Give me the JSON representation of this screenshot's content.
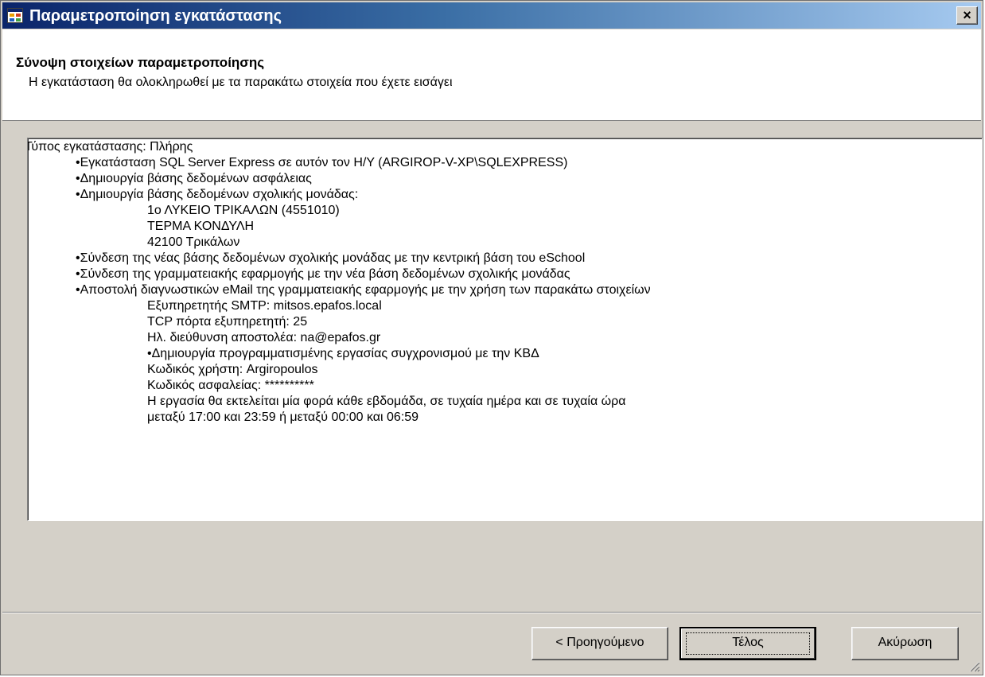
{
  "window": {
    "title": "Παραμετροποίηση εγκατάστασης",
    "close_glyph": "×",
    "icon": "app-window-icon"
  },
  "header": {
    "title": "Σύνοψη στοιχείων παραμετροποίησης",
    "subtitle": "Η εγκατάσταση θα ολοκληρωθεί με τα παρακάτω στοιχεία που έχετε εισάγει"
  },
  "summary": {
    "lines": [
      "Τύπος εγκατάστασης: Πλήρης",
      "•Εγκατάσταση SQL Server Express σε αυτόν τον Η/Υ (ARGIROP-V-XP\\SQLEXPRESS)",
      "•Δημιουργία βάσης δεδομένων ασφάλειας",
      "•Δημιουργία βάσης δεδομένων σχολικής μονάδας:",
      "1ο ΛΥΚΕΙΟ ΤΡΙΚΑΛΩΝ (4551010)",
      "ΤΕΡΜΑ ΚΟΝΔΥΛΗ",
      "42100 Τρικάλων",
      "•Σύνδεση της νέας βάσης δεδομένων σχολικής μονάδας με την κεντρική βάση του eSchool",
      "•Σύνδεση της γραμματειακής εφαρμογής με την νέα βάση δεδομένων σχολικής μονάδας",
      "•Αποστολή διαγνωστικών eMail της γραμματειακής εφαρμογής με την χρήση των παρακάτω στοιχείων",
      "Εξυπηρετητής SMTP: mitsos.epafos.local",
      "TCP πόρτα εξυπηρετητή: 25",
      "Ηλ. διεύθυνση αποστολέα: na@epafos.gr",
      "•Δημιουργία προγραμματισμένης εργασίας συγχρονισμού με την ΚΒΔ",
      "Κωδικός χρήστη: Argiropoulos",
      "Κωδικός ασφαλείας: **********",
      "Η εργασία θα εκτελείται μία φορά κάθε εβδομάδα, σε τυχαία ημέρα και σε τυχαία ώρα",
      "μεταξύ 17:00 και 23:59 ή μεταξύ 00:00 και 06:59"
    ]
  },
  "buttons": {
    "back": "< Προηγούμενο",
    "finish": "Τέλος",
    "cancel": "Ακύρωση"
  },
  "colors": {
    "dialog_bg": "#d4d0c8",
    "titlebar_start": "#0a246a",
    "titlebar_end": "#a6caf0",
    "text": "#000000"
  }
}
